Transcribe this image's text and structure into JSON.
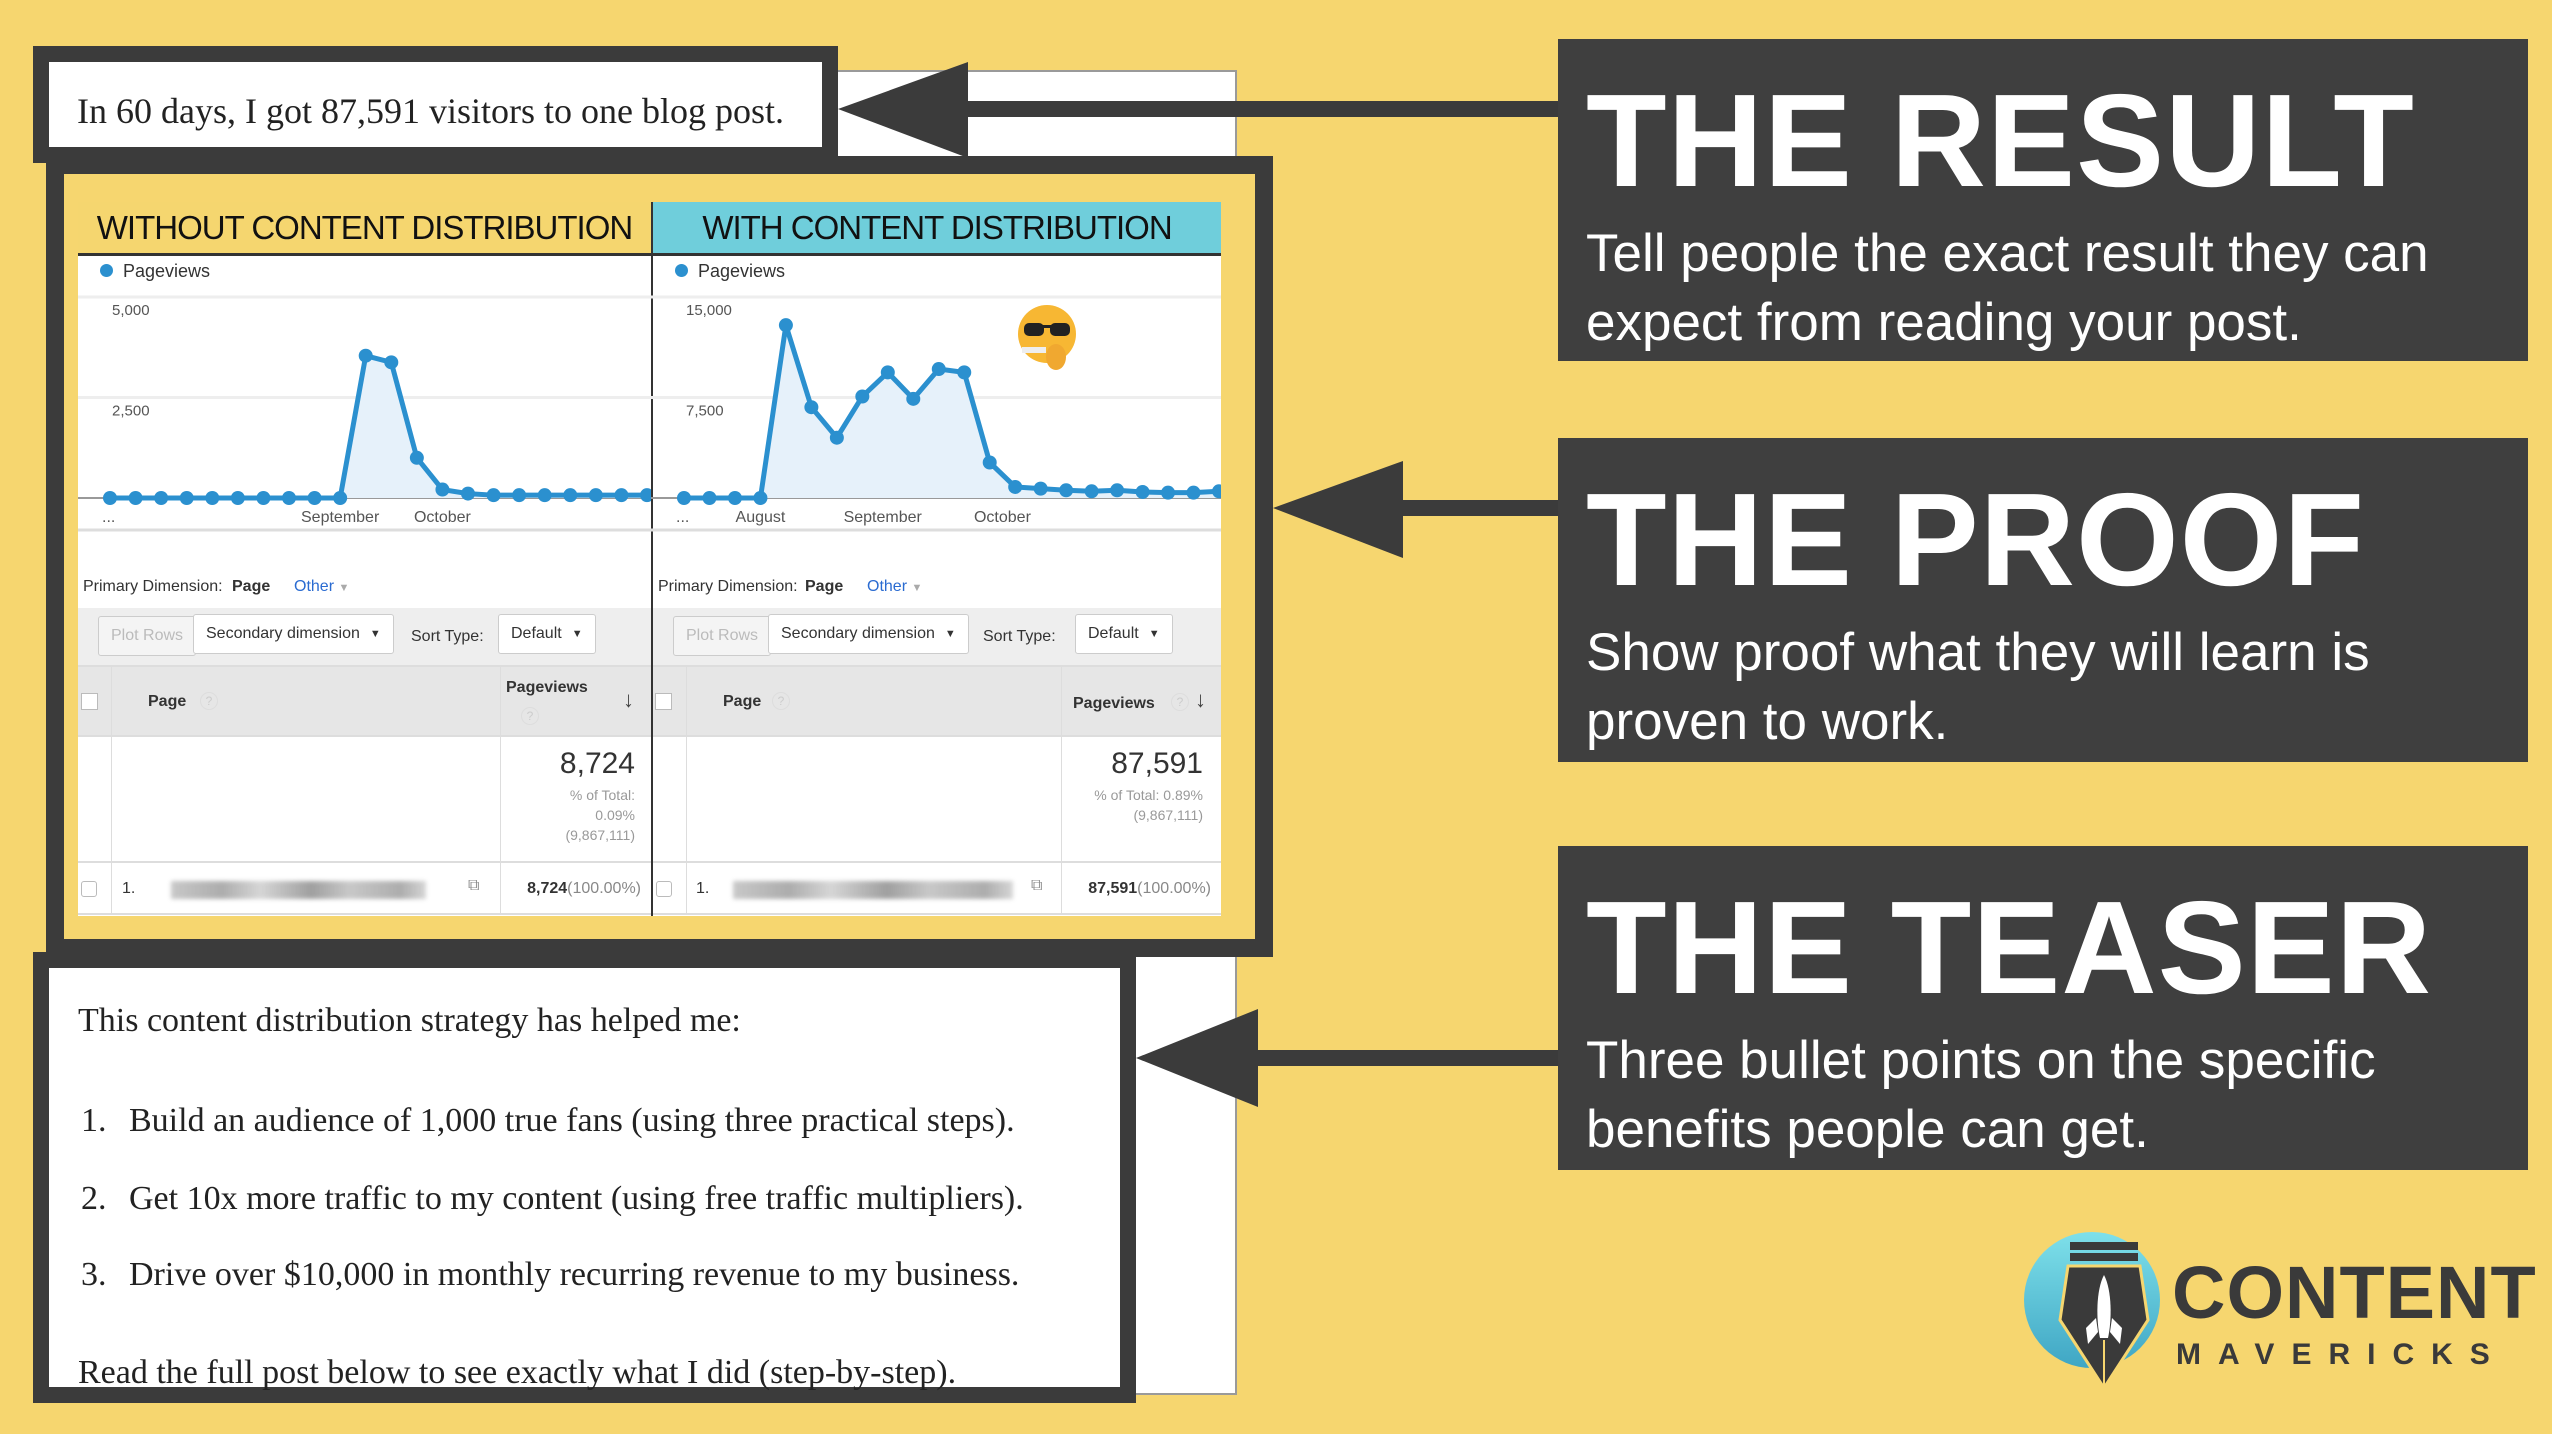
{
  "result_line": "In 60 days, I got 87,591 visitors to one blog post.",
  "panels": [
    {
      "header": "WITHOUT CONTENT DISTRIBUTION",
      "header_color": "#F5D66F",
      "legend": "Pageviews",
      "primary_dimension_label": "Primary Dimension:",
      "primary_dimension_value": "Page",
      "other_label": "Other",
      "plot_rows": "Plot Rows",
      "secondary_dimension": "Secondary dimension",
      "sort_type_label": "Sort Type:",
      "sort_type_value": "Default",
      "col_page": "Page",
      "col_pageviews": "Pageviews",
      "total": "8,724",
      "total_pct_line1": "% of Total:",
      "total_pct_line2": "0.09%",
      "total_pct_line3": "(9,867,111)",
      "row_index": "1.",
      "row_value": "8,724",
      "row_pct": "(100.00%)"
    },
    {
      "header": "WITH CONTENT DISTRIBUTION",
      "header_color": "#6FCEDB",
      "legend": "Pageviews",
      "primary_dimension_label": "Primary Dimension:",
      "primary_dimension_value": "Page",
      "other_label": "Other",
      "plot_rows": "Plot Rows",
      "secondary_dimension": "Secondary dimension",
      "sort_type_label": "Sort Type:",
      "sort_type_value": "Default",
      "col_page": "Page",
      "col_pageviews": "Pageviews",
      "total": "87,591",
      "total_pct_line1": "% of Total: 0.89%",
      "total_pct_line2": "",
      "total_pct_line3": "(9,867,111)",
      "row_index": "1.",
      "row_value": "87,591",
      "row_pct": "(100.00%)"
    }
  ],
  "chart_data": [
    {
      "type": "area",
      "series": [
        {
          "name": "Pageviews",
          "values": [
            0,
            0,
            0,
            0,
            0,
            0,
            0,
            0,
            0,
            0,
            3540,
            3375,
            1000,
            210,
            110,
            70,
            70,
            70,
            70,
            70,
            70,
            70
          ]
        }
      ],
      "ylim": [
        0,
        5000
      ],
      "yticks": [
        "2,500",
        "5,000"
      ],
      "xticks": [
        {
          "label": "...",
          "at": 0
        },
        {
          "label": "September",
          "at": 9
        },
        {
          "label": "October",
          "at": 13
        }
      ],
      "color": "#2B90CF"
    },
    {
      "type": "area",
      "series": [
        {
          "name": "Pageviews",
          "values": [
            0,
            0,
            0,
            0,
            12900,
            6775,
            4500,
            7575,
            9375,
            7400,
            9625,
            9375,
            2650,
            825,
            700,
            575,
            500,
            575,
            450,
            400,
            400,
            500
          ]
        }
      ],
      "ylim": [
        0,
        15000
      ],
      "yticks": [
        "7,500",
        "15,000"
      ],
      "xticks": [
        {
          "label": "...",
          "at": 0
        },
        {
          "label": "August",
          "at": 3
        },
        {
          "label": "September",
          "at": 7.8
        },
        {
          "label": "October",
          "at": 12.5
        }
      ],
      "color": "#2B90CF"
    }
  ],
  "teaser": {
    "intro": "This content distribution strategy has helped me:",
    "items": [
      {
        "num": "1.",
        "text": "Build an audience of 1,000 true fans (using three practical steps)."
      },
      {
        "num": "2.",
        "text": "Get 10x more traffic to my content (using free traffic multipliers)."
      },
      {
        "num": "3.",
        "text": "Drive over $10,000 in monthly recurring revenue to my business."
      }
    ],
    "outro": "Read the full post below to see exactly what I did (step-by-step)."
  },
  "callouts": [
    {
      "title": "THE RESULT",
      "line1": "Tell people the exact result they can",
      "line2": "expect from reading your post."
    },
    {
      "title": "THE PROOF",
      "line1": "Show proof what they will learn is",
      "line2": "proven to work."
    },
    {
      "title": "THE TEASER",
      "line1": "Three bullet points on the specific",
      "line2": "benefits people can get."
    }
  ],
  "logo": {
    "line1": "CONTENT",
    "line2": "MAVERICKS"
  },
  "colors": {
    "background": "#F6D66F",
    "dark": "#3F3F3F",
    "cyan": "#6FCEDB",
    "chart": "#2B90CF"
  }
}
